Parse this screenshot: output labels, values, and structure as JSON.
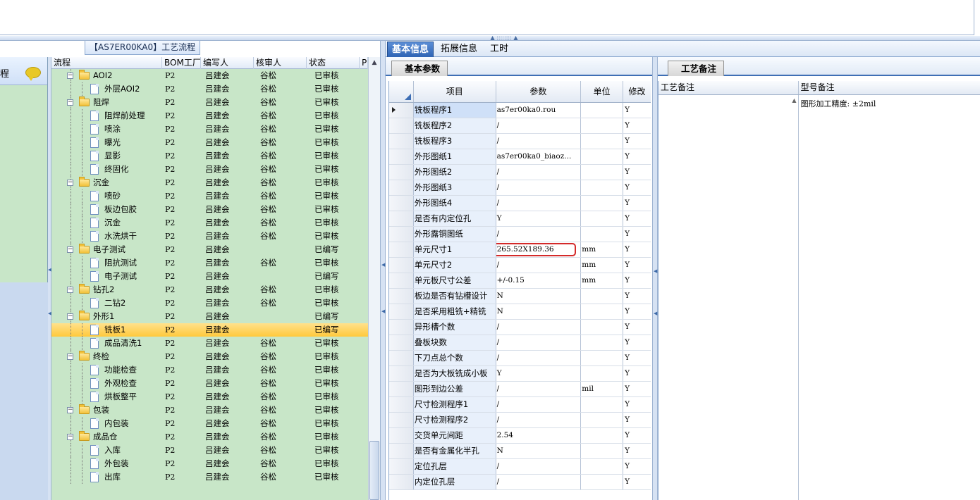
{
  "tree_title": "【AS7ER00KA0】工艺流程",
  "left_panel": {
    "label": "程"
  },
  "tree_columns": [
    "流程",
    "BOM工厂",
    "编写人",
    "核审人",
    "状态",
    "P"
  ],
  "tree_rows": [
    {
      "level": 0,
      "type": "folder",
      "name": "AOI2",
      "bom": "P2",
      "writer": "吕建会",
      "checker": "谷松",
      "status": "已审核"
    },
    {
      "level": 1,
      "type": "doc",
      "name": "外层AOI2",
      "bom": "P2",
      "writer": "吕建会",
      "checker": "谷松",
      "status": "已审核"
    },
    {
      "level": 0,
      "type": "folder",
      "name": "阻焊",
      "bom": "P2",
      "writer": "吕建会",
      "checker": "谷松",
      "status": "已审核"
    },
    {
      "level": 1,
      "type": "doc",
      "name": "阻焊前处理",
      "bom": "P2",
      "writer": "吕建会",
      "checker": "谷松",
      "status": "已审核"
    },
    {
      "level": 1,
      "type": "doc",
      "name": "喷涂",
      "bom": "P2",
      "writer": "吕建会",
      "checker": "谷松",
      "status": "已审核"
    },
    {
      "level": 1,
      "type": "doc",
      "name": "曝光",
      "bom": "P2",
      "writer": "吕建会",
      "checker": "谷松",
      "status": "已审核"
    },
    {
      "level": 1,
      "type": "doc",
      "name": "显影",
      "bom": "P2",
      "writer": "吕建会",
      "checker": "谷松",
      "status": "已审核"
    },
    {
      "level": 1,
      "type": "doc",
      "name": "终固化",
      "bom": "P2",
      "writer": "吕建会",
      "checker": "谷松",
      "status": "已审核"
    },
    {
      "level": 0,
      "type": "folder",
      "name": "沉金",
      "bom": "P2",
      "writer": "吕建会",
      "checker": "谷松",
      "status": "已审核"
    },
    {
      "level": 1,
      "type": "doc",
      "name": "喷砂",
      "bom": "P2",
      "writer": "吕建会",
      "checker": "谷松",
      "status": "已审核"
    },
    {
      "level": 1,
      "type": "doc",
      "name": "板边包胶",
      "bom": "P2",
      "writer": "吕建会",
      "checker": "谷松",
      "status": "已审核"
    },
    {
      "level": 1,
      "type": "doc",
      "name": "沉金",
      "bom": "P2",
      "writer": "吕建会",
      "checker": "谷松",
      "status": "已审核"
    },
    {
      "level": 1,
      "type": "doc",
      "name": "水洗烘干",
      "bom": "P2",
      "writer": "吕建会",
      "checker": "谷松",
      "status": "已审核"
    },
    {
      "level": 0,
      "type": "folder",
      "name": "电子测试",
      "bom": "P2",
      "writer": "吕建会",
      "checker": "",
      "status": "已编写"
    },
    {
      "level": 1,
      "type": "doc",
      "name": "阻抗测试",
      "bom": "P2",
      "writer": "吕建会",
      "checker": "谷松",
      "status": "已审核"
    },
    {
      "level": 1,
      "type": "doc",
      "name": "电子测试",
      "bom": "P2",
      "writer": "吕建会",
      "checker": "",
      "status": "已编写"
    },
    {
      "level": 0,
      "type": "folder",
      "name": "钻孔2",
      "bom": "P2",
      "writer": "吕建会",
      "checker": "谷松",
      "status": "已审核"
    },
    {
      "level": 1,
      "type": "doc",
      "name": "二钻2",
      "bom": "P2",
      "writer": "吕建会",
      "checker": "谷松",
      "status": "已审核"
    },
    {
      "level": 0,
      "type": "folder",
      "name": "外形1",
      "bom": "P2",
      "writer": "吕建会",
      "checker": "",
      "status": "已编写"
    },
    {
      "level": 1,
      "type": "doc",
      "name": "铣板1",
      "bom": "P2",
      "writer": "吕建会",
      "checker": "",
      "status": "已编写",
      "selected": true
    },
    {
      "level": 1,
      "type": "doc",
      "name": "成品清洗1",
      "bom": "P2",
      "writer": "吕建会",
      "checker": "谷松",
      "status": "已审核"
    },
    {
      "level": 0,
      "type": "folder",
      "name": "终检",
      "bom": "P2",
      "writer": "吕建会",
      "checker": "谷松",
      "status": "已审核"
    },
    {
      "level": 1,
      "type": "doc",
      "name": "功能检查",
      "bom": "P2",
      "writer": "吕建会",
      "checker": "谷松",
      "status": "已审核"
    },
    {
      "level": 1,
      "type": "doc",
      "name": "外观检查",
      "bom": "P2",
      "writer": "吕建会",
      "checker": "谷松",
      "status": "已审核"
    },
    {
      "level": 1,
      "type": "doc",
      "name": "烘板整平",
      "bom": "P2",
      "writer": "吕建会",
      "checker": "谷松",
      "status": "已审核"
    },
    {
      "level": 0,
      "type": "folder",
      "name": "包装",
      "bom": "P2",
      "writer": "吕建会",
      "checker": "谷松",
      "status": "已审核"
    },
    {
      "level": 1,
      "type": "doc",
      "name": "内包装",
      "bom": "P2",
      "writer": "吕建会",
      "checker": "谷松",
      "status": "已审核"
    },
    {
      "level": 0,
      "type": "folder",
      "name": "成品仓",
      "bom": "P2",
      "writer": "吕建会",
      "checker": "谷松",
      "status": "已审核"
    },
    {
      "level": 1,
      "type": "doc",
      "name": "入库",
      "bom": "P2",
      "writer": "吕建会",
      "checker": "谷松",
      "status": "已审核"
    },
    {
      "level": 1,
      "type": "doc",
      "name": "外包装",
      "bom": "P2",
      "writer": "吕建会",
      "checker": "谷松",
      "status": "已审核"
    },
    {
      "level": 1,
      "type": "doc",
      "name": "出库",
      "bom": "P2",
      "writer": "吕建会",
      "checker": "谷松",
      "status": "已审核"
    }
  ],
  "main_tabs": [
    "基本信息",
    "拓展信息",
    "工时"
  ],
  "params_tab": "基本参数",
  "params_columns": [
    "项目",
    "参数",
    "单位",
    "修改"
  ],
  "params_rows": [
    {
      "item": "铣板程序1",
      "param": "as7er00ka0.rou",
      "unit": "",
      "mod": "Y",
      "current": true
    },
    {
      "item": "铣板程序2",
      "param": "/",
      "unit": "",
      "mod": "Y"
    },
    {
      "item": "铣板程序3",
      "param": "/",
      "unit": "",
      "mod": "Y"
    },
    {
      "item": "外形图纸1",
      "param": "as7er00ka0_biaoz...",
      "unit": "",
      "mod": "Y"
    },
    {
      "item": "外形图纸2",
      "param": "/",
      "unit": "",
      "mod": "Y"
    },
    {
      "item": "外形图纸3",
      "param": "/",
      "unit": "",
      "mod": "Y"
    },
    {
      "item": "外形图纸4",
      "param": "/",
      "unit": "",
      "mod": "Y"
    },
    {
      "item": "是否有内定位孔",
      "param": "Y",
      "unit": "",
      "mod": "Y"
    },
    {
      "item": "外形露铜图纸",
      "param": "/",
      "unit": "",
      "mod": "Y"
    },
    {
      "item": "单元尺寸1",
      "param": "265.52X189.36",
      "unit": "mm",
      "mod": "Y",
      "highlight": true
    },
    {
      "item": "单元尺寸2",
      "param": "/",
      "unit": "mm",
      "mod": "Y"
    },
    {
      "item": "单元板尺寸公差",
      "param": "+/-0.15",
      "unit": "mm",
      "mod": "Y"
    },
    {
      "item": "板边是否有钻槽设计",
      "param": "N",
      "unit": "",
      "mod": "Y"
    },
    {
      "item": "是否采用粗铣+精铣",
      "param": "N",
      "unit": "",
      "mod": "Y"
    },
    {
      "item": "异形槽个数",
      "param": "/",
      "unit": "",
      "mod": "Y"
    },
    {
      "item": "叠板块数",
      "param": "/",
      "unit": "",
      "mod": "Y"
    },
    {
      "item": "下刀点总个数",
      "param": "/",
      "unit": "",
      "mod": "Y"
    },
    {
      "item": "是否为大板铣成小板",
      "param": "Y",
      "unit": "",
      "mod": "Y"
    },
    {
      "item": "图形到边公差",
      "param": "/",
      "unit": "mil",
      "mod": "Y"
    },
    {
      "item": "尺寸检测程序1",
      "param": "/",
      "unit": "",
      "mod": "Y"
    },
    {
      "item": "尺寸检测程序2",
      "param": "/",
      "unit": "",
      "mod": "Y"
    },
    {
      "item": "交货单元间距",
      "param": "2.54",
      "unit": "",
      "mod": "Y"
    },
    {
      "item": "是否有金属化半孔",
      "param": "N",
      "unit": "",
      "mod": "Y"
    },
    {
      "item": "定位孔层",
      "param": "/",
      "unit": "",
      "mod": "Y"
    },
    {
      "item": "内定位孔层",
      "param": "/",
      "unit": "",
      "mod": "Y"
    }
  ],
  "notes_tab": "工艺备注",
  "notes_columns": [
    "工艺备注",
    "型号备注"
  ],
  "notes_model_text": "图形加工精度: ±2mil"
}
